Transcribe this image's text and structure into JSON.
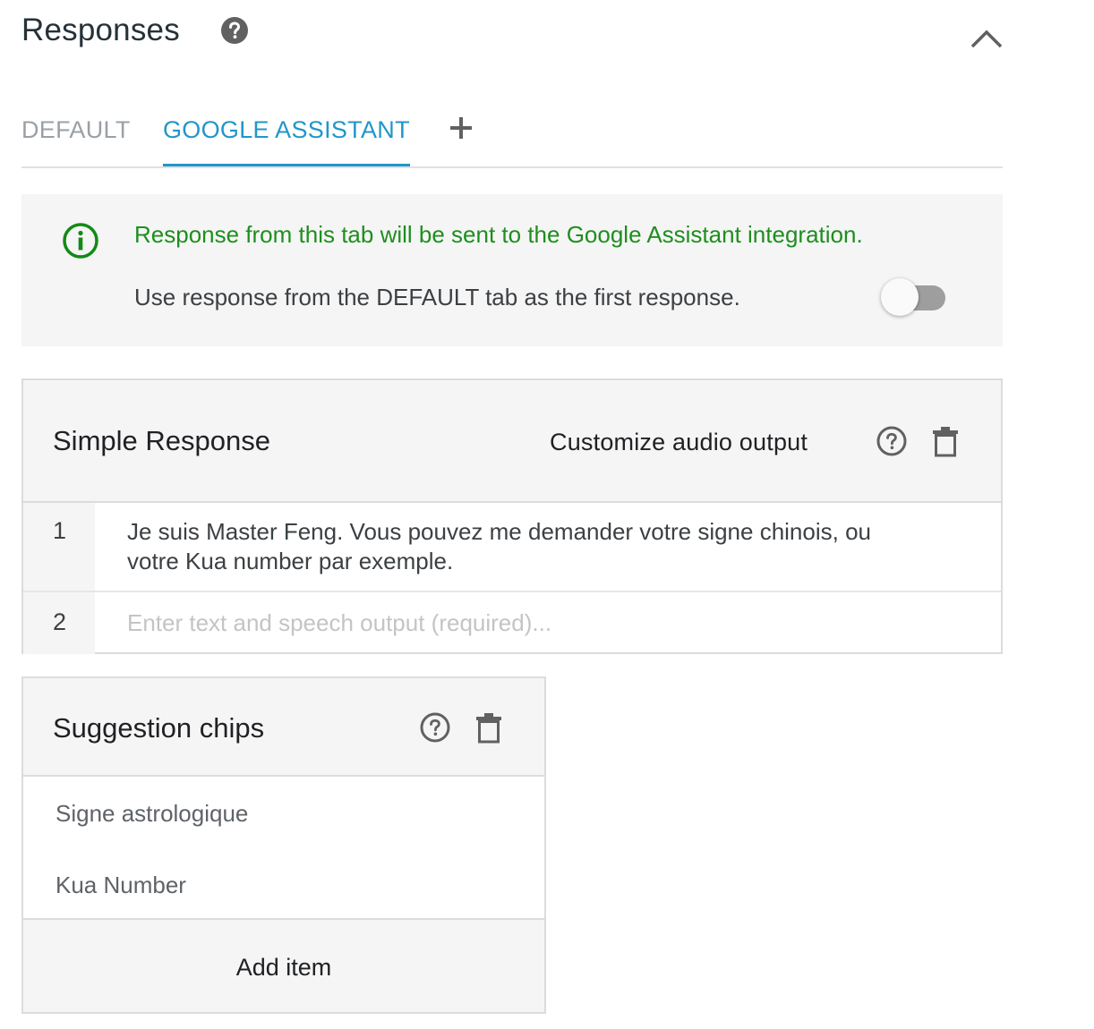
{
  "header": {
    "title": "Responses"
  },
  "tabs": [
    {
      "label": "DEFAULT",
      "active": false
    },
    {
      "label": "GOOGLE ASSISTANT",
      "active": true
    }
  ],
  "info_banner": {
    "message": "Response from this tab will be sent to the Google Assistant integration.",
    "toggle_label": "Use response from the DEFAULT tab as the first response.",
    "toggle_on": false
  },
  "simple_response": {
    "title": "Simple Response",
    "customize_label": "Customize audio output",
    "rows": [
      {
        "number": "1",
        "text": "Je suis Master Feng. Vous pouvez me demander votre signe chinois, ou votre Kua number par exemple."
      },
      {
        "number": "2",
        "placeholder": "Enter text and speech output (required)..."
      }
    ]
  },
  "suggestion_chips": {
    "title": "Suggestion chips",
    "items": [
      "Signe astrologique",
      "Kua Number"
    ],
    "add_label": "Add item"
  },
  "colors": {
    "accent": "#2196c9",
    "success_text": "#1e8e1e",
    "panel_bg": "#f5f5f5",
    "border": "#dcdcdc"
  }
}
